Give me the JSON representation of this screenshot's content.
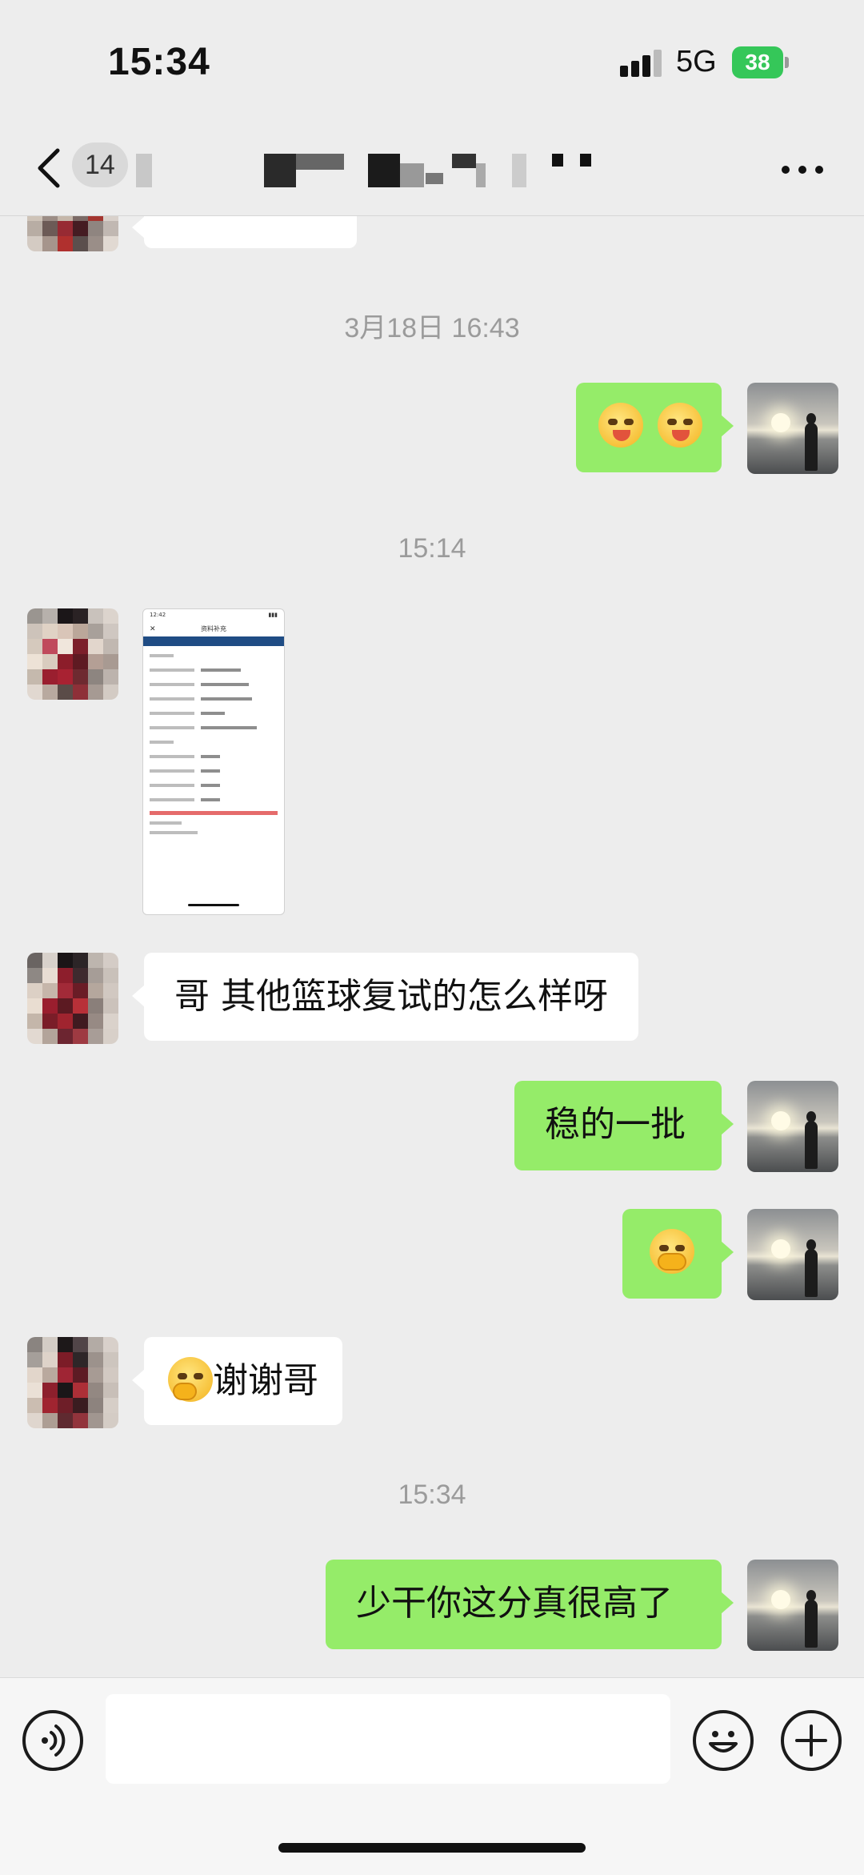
{
  "status_bar": {
    "time": "15:34",
    "network": "5G",
    "battery": "38"
  },
  "nav": {
    "unread_badge": "14"
  },
  "messages": {
    "timestamp_1": "3月18日 16:43",
    "timestamp_2": "15:14",
    "incoming_question": "哥 其他篮球复试的怎么样呀",
    "outgoing_reply_1": "稳的一批",
    "incoming_thanks": "谢谢哥",
    "timestamp_3": "15:34",
    "outgoing_reply_2": "少干你这分真很高了"
  },
  "shared_screenshot": {
    "time": "12:42",
    "title": "资料补充"
  },
  "input": {
    "placeholder": ""
  }
}
